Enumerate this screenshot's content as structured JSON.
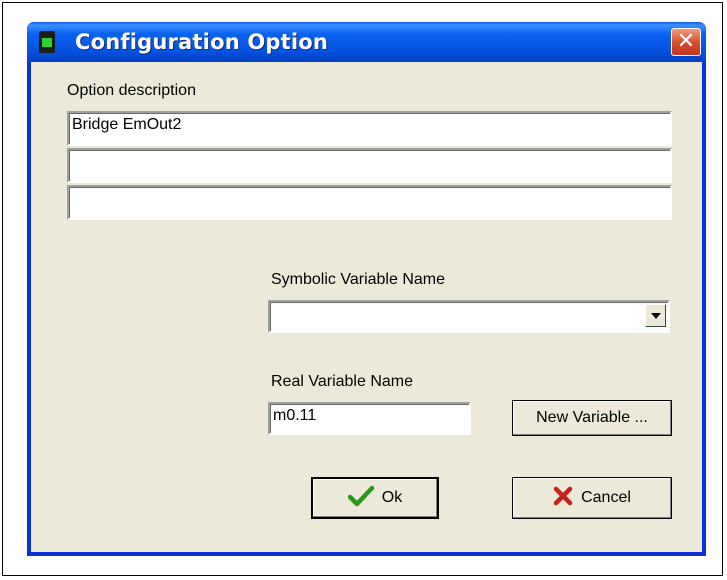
{
  "window": {
    "title": "Configuration Option",
    "close_glyph": "✕"
  },
  "form": {
    "option_description_label": "Option description",
    "description_lines": [
      "Bridge EmOut2",
      "",
      ""
    ],
    "symbolic_variable_label": "Symbolic Variable Name",
    "symbolic_variable_value": "",
    "real_variable_label": "Real Variable Name",
    "real_variable_value": "m0.11"
  },
  "buttons": {
    "new_variable": "New Variable ...",
    "ok": "Ok",
    "cancel": "Cancel"
  },
  "icons": {
    "ok": "green-checkmark-icon",
    "cancel": "red-x-icon",
    "app": "app-icon"
  },
  "colors": {
    "titlebar": "#0553e0",
    "window_bg": "#ece9d8",
    "close": "#d4492b",
    "check": "#2a9a1a",
    "cross": "#c8201a"
  }
}
